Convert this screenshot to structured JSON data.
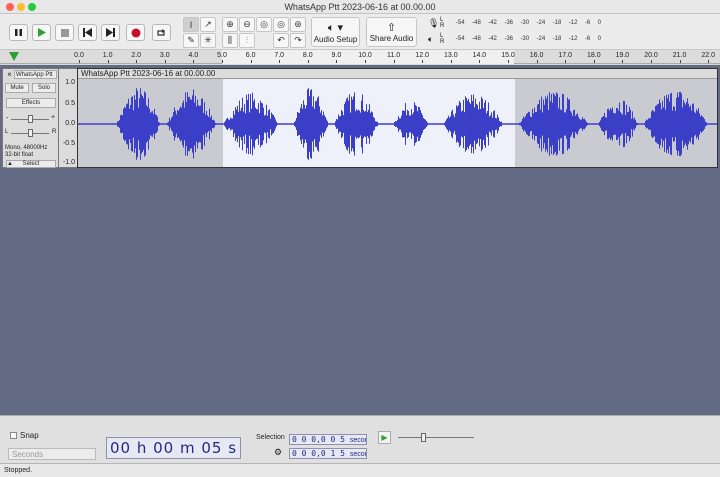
{
  "window": {
    "title": "WhatsApp Ptt 2023-06-16 at 00.00.00"
  },
  "toolbar": {
    "transport": {
      "pause": "pause",
      "play": "play",
      "stop": "stop",
      "skip_start": "skip-start",
      "skip_end": "skip-end",
      "record": "record",
      "loop": "loop"
    },
    "audio_setup_label": "Audio Setup",
    "share_audio_label": "Share Audio",
    "meter_scale": [
      "-54",
      "-48",
      "-42",
      "-36",
      "-30",
      "-24",
      "-18",
      "-12",
      "-6",
      "0"
    ],
    "meter_channels": {
      "left": "L",
      "right": "R"
    }
  },
  "ruler": {
    "ticks": [
      "0.0",
      "1.0",
      "2.0",
      "3.0",
      "4.0",
      "5.0",
      "6.0",
      "7.0",
      "8.0",
      "9.0",
      "10.0",
      "11.0",
      "12.0",
      "13.0",
      "14.0",
      "15.0",
      "16.0",
      "17.0",
      "18.0",
      "19.0",
      "20.0",
      "21.0",
      "22.0"
    ]
  },
  "track": {
    "name": "WhatsApp Ptt",
    "clip_title": "WhatsApp Ptt 2023-06-16 at 00.00.00",
    "close": "×",
    "mute_label": "Mute",
    "solo_label": "Solo",
    "effects_label": "Effects",
    "info_line1": "Mono, 48000Hz",
    "info_line2": "32-bit float",
    "select_label": "Select",
    "scale": [
      "1.0",
      "0.5",
      "0.0",
      "-0.5",
      "-1.0"
    ]
  },
  "bottom": {
    "snap_label": "Snap",
    "snap_unit": "Seconds",
    "time_display": "00 h 00 m 05 s",
    "selection_label": "Selection",
    "selection_start": "0 0 0,0 0 5",
    "selection_end": "0 0 0,0 1 5",
    "selection_unit": "seconds"
  },
  "status": {
    "text": "Stopped."
  },
  "colors": {
    "waveform": "#3b3fc8",
    "background": "#636b84",
    "selection": "#eef0fa"
  }
}
